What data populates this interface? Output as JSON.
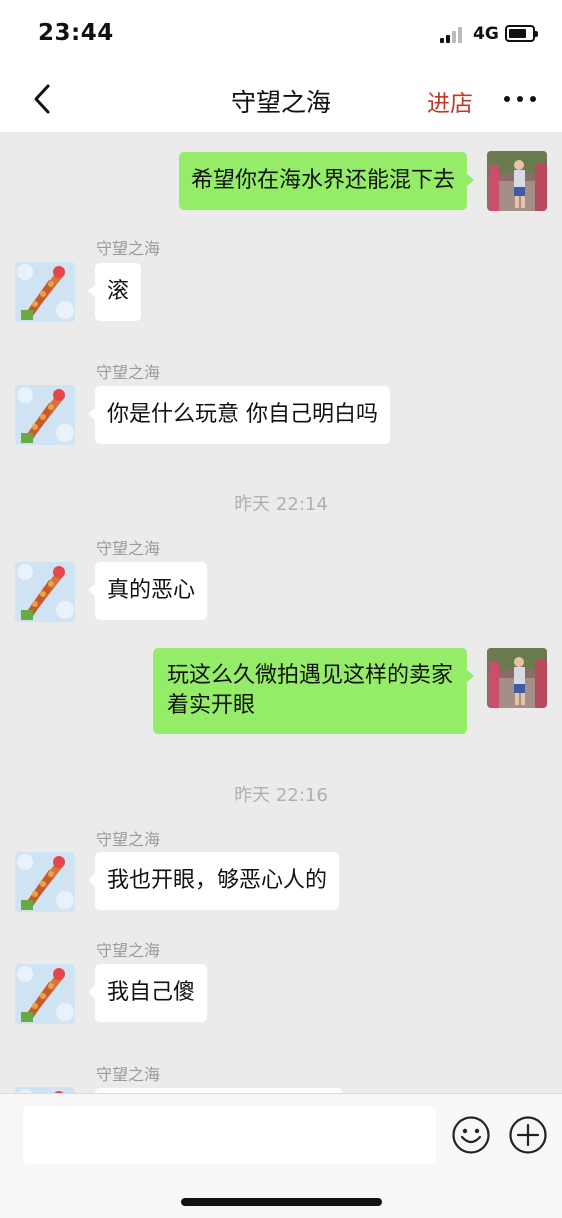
{
  "status_bar": {
    "time": "23:44",
    "network": "4G"
  },
  "nav": {
    "title": "守望之海",
    "store_label": "进店"
  },
  "messages": [
    {
      "kind": "out",
      "text": "希望你在海水界还能混下去"
    },
    {
      "kind": "in",
      "sender": "守望之海",
      "text": "滚"
    },
    {
      "kind": "in",
      "sender": "守望之海",
      "text": "你是什么玩意 你自己明白吗"
    },
    {
      "kind": "time",
      "text": "昨天 22:14"
    },
    {
      "kind": "in",
      "sender": "守望之海",
      "text": "真的恶心"
    },
    {
      "kind": "out",
      "text": "玩这么久微拍遇见这样的卖家着实开眼",
      "lines": [
        "玩这么久微拍遇见这样的卖家",
        "着实开眼"
      ]
    },
    {
      "kind": "time",
      "text": "昨天 22:16"
    },
    {
      "kind": "in",
      "sender": "守望之海",
      "text": "我也开眼，够恶心人的"
    },
    {
      "kind": "in",
      "sender": "守望之海",
      "text": "我自己傻"
    },
    {
      "kind": "in",
      "sender": "守望之海",
      "text": ""
    }
  ],
  "input": {
    "placeholder": ""
  },
  "colors": {
    "outgoing_bubble": "#95ec69",
    "incoming_bubble": "#ffffff",
    "chat_background": "#ebebeb",
    "store_link": "#c0392b"
  },
  "icons": {
    "back": "chevron-left-icon",
    "more": "more-dots-icon",
    "emoji": "emoji-icon",
    "add": "plus-circle-icon"
  }
}
